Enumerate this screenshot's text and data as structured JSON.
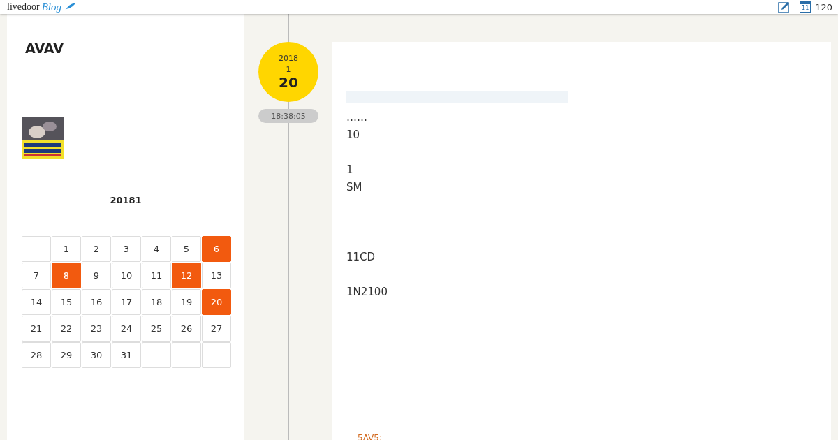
{
  "header": {
    "logo_text": "livedoor",
    "logo_blog": "Blog",
    "calendar_icon_day": "11",
    "count": "120"
  },
  "sidebar": {
    "blog_title": "AVAV",
    "calendar": {
      "title": "20181",
      "days": [
        {
          "kind": "empty"
        },
        {
          "kind": "day",
          "day": "1",
          "highlighted": false
        },
        {
          "kind": "day",
          "day": "2",
          "highlighted": false
        },
        {
          "kind": "day",
          "day": "3",
          "highlighted": false
        },
        {
          "kind": "day",
          "day": "4",
          "highlighted": false
        },
        {
          "kind": "day",
          "day": "5",
          "highlighted": false
        },
        {
          "kind": "day",
          "day": "6",
          "highlighted": true
        },
        {
          "kind": "day",
          "day": "7",
          "highlighted": false
        },
        {
          "kind": "day",
          "day": "8",
          "highlighted": true
        },
        {
          "kind": "day",
          "day": "9",
          "highlighted": false
        },
        {
          "kind": "day",
          "day": "10",
          "highlighted": false
        },
        {
          "kind": "day",
          "day": "11",
          "highlighted": false
        },
        {
          "kind": "day",
          "day": "12",
          "highlighted": true
        },
        {
          "kind": "day",
          "day": "13",
          "highlighted": false
        },
        {
          "kind": "day",
          "day": "14",
          "highlighted": false
        },
        {
          "kind": "day",
          "day": "15",
          "highlighted": false
        },
        {
          "kind": "day",
          "day": "16",
          "highlighted": false
        },
        {
          "kind": "day",
          "day": "17",
          "highlighted": false
        },
        {
          "kind": "day",
          "day": "18",
          "highlighted": false
        },
        {
          "kind": "day",
          "day": "19",
          "highlighted": false
        },
        {
          "kind": "day",
          "day": "20",
          "highlighted": true
        },
        {
          "kind": "day",
          "day": "21",
          "highlighted": false
        },
        {
          "kind": "day",
          "day": "22",
          "highlighted": false
        },
        {
          "kind": "day",
          "day": "23",
          "highlighted": false
        },
        {
          "kind": "day",
          "day": "24",
          "highlighted": false
        },
        {
          "kind": "day",
          "day": "25",
          "highlighted": false
        },
        {
          "kind": "day",
          "day": "26",
          "highlighted": false
        },
        {
          "kind": "day",
          "day": "27",
          "highlighted": false
        },
        {
          "kind": "day",
          "day": "28",
          "highlighted": false
        },
        {
          "kind": "day",
          "day": "29",
          "highlighted": false
        },
        {
          "kind": "day",
          "day": "30",
          "highlighted": false
        },
        {
          "kind": "day",
          "day": "31",
          "highlighted": false
        },
        {
          "kind": "empty"
        },
        {
          "kind": "empty"
        },
        {
          "kind": "empty"
        }
      ]
    }
  },
  "post": {
    "date": {
      "year": "2018",
      "month": "1",
      "day": "20"
    },
    "time": "18:38:05",
    "lines": [
      {
        "kind": "text",
        "text": "……"
      },
      {
        "kind": "text",
        "text": "10"
      },
      {
        "kind": "blank"
      },
      {
        "kind": "text",
        "text": "1"
      },
      {
        "kind": "text",
        "text": "SM"
      },
      {
        "kind": "blank"
      },
      {
        "kind": "blank"
      },
      {
        "kind": "blank"
      },
      {
        "kind": "text",
        "text": "11CD"
      },
      {
        "kind": "blank"
      },
      {
        "kind": "text",
        "text": "1N2100"
      }
    ],
    "link": "5AV5:"
  }
}
